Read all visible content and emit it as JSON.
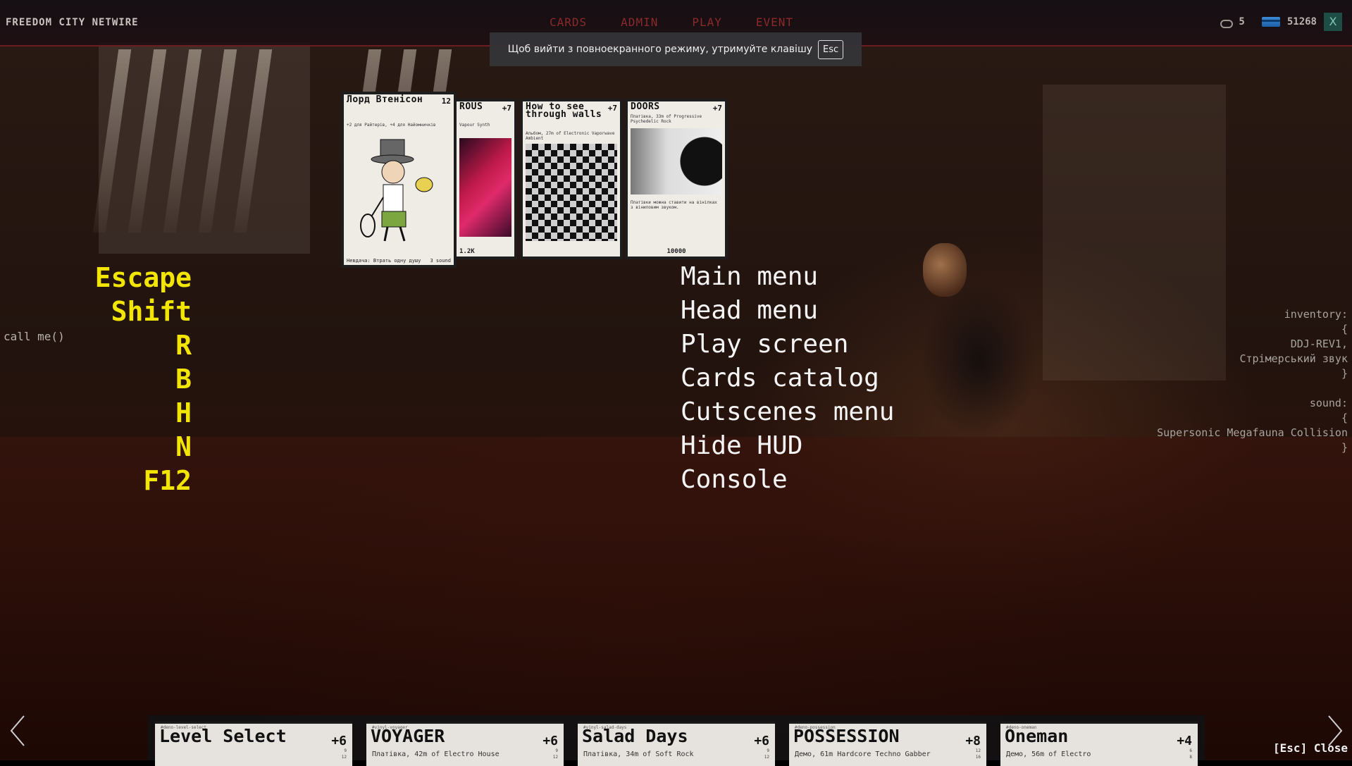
{
  "topbar": {
    "brand": "FREEDOM CITY NETWIRE",
    "nav": [
      "CARDS",
      "ADMIN",
      "PLAY",
      "EVENT"
    ],
    "cloud_count": "5",
    "credits": "51268",
    "close_label": "X"
  },
  "toast": {
    "message": "Щоб вийти з повноекранного режиму, утримуйте клавішу",
    "key": "Esc"
  },
  "cards_top": [
    {
      "title": "Лорд Втенісон",
      "value": "12",
      "sub": "+2 для Райтерів, +4 для Найомничків",
      "foot": "Невдача: Втрать одну душу",
      "foot_right": "3 sound"
    },
    {
      "title": "ROUS",
      "value": "+7",
      "sub": "Vapour Synth",
      "foot": "1.2K"
    },
    {
      "title": "How to see through walls",
      "value": "+7",
      "sub": "Альбом, 27m of Electronic Vaporwave Ambient",
      "foot": ""
    },
    {
      "title": "DOORS",
      "value": "+7",
      "sub": "Платівка, 33m of Progressive Psychedelic Rock",
      "body": "Платівки можна ставити на вінілках з віниловим звуком.",
      "foot": "10000"
    }
  ],
  "menu": [
    {
      "key": "Escape",
      "label": "Main menu"
    },
    {
      "key": "Shift",
      "label": "Head menu"
    },
    {
      "key": "R",
      "label": "Play screen"
    },
    {
      "key": "B",
      "label": "Cards catalog"
    },
    {
      "key": "H",
      "label": "Cutscenes menu"
    },
    {
      "key": "N",
      "label": "Hide HUD"
    },
    {
      "key": "F12",
      "label": "Console"
    }
  ],
  "console_hint": "call me()",
  "inventory": {
    "text": "inventory:\n{\nDDJ-REV1,\nСтрімерський звук\n}\n\nsound:\n{\nSupersonic Megafauna Collision\n}"
  },
  "cards_bottom": [
    {
      "tiny": "#deno-level-select",
      "title": "Level Select",
      "value": "+6",
      "sub": "",
      "mini": "9\n12"
    },
    {
      "tiny": "#vinyl-voyager",
      "title": "VOYAGER",
      "value": "+6",
      "sub": "Платівка, 42m of Electro House",
      "mini": "9\n12"
    },
    {
      "tiny": "#vinyl-salad-days",
      "title": "Salad Days",
      "value": "+6",
      "sub": "Платівка, 34m of Soft Rock",
      "mini": "9\n12"
    },
    {
      "tiny": "#deno-possession",
      "title": "POSSESSION",
      "value": "+8",
      "sub": "Демо, 61m Hardcore Techno Gabber",
      "mini": "12\n16"
    },
    {
      "tiny": "#deno-oneman",
      "title": "Oneman",
      "value": "+4",
      "sub": "Демо, 56m of Electro",
      "mini": "6\n8"
    }
  ],
  "esc_close": "[Esc] Close",
  "icons": {
    "cloud": "cloud-icon",
    "credit": "credit-card-icon",
    "prev": "chevron-left-icon",
    "next": "chevron-right-icon"
  }
}
